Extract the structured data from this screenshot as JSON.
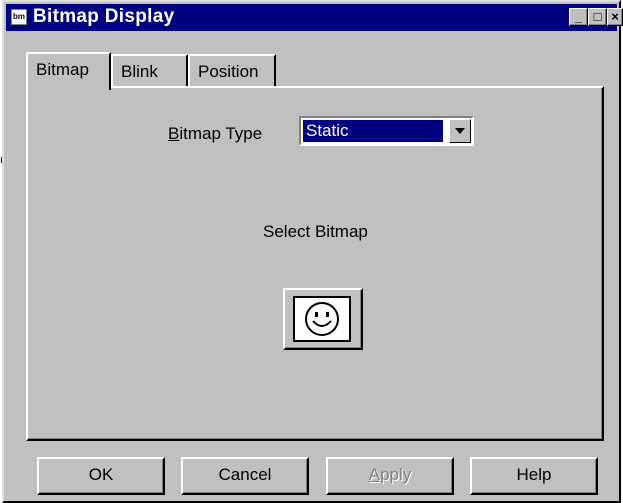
{
  "window": {
    "title": "Bitmap Display",
    "app_icon_text": "bm"
  },
  "caption_buttons": {
    "minimize": "_",
    "maximize": "□",
    "close": "×"
  },
  "edge_fragment": "o",
  "tabs": [
    {
      "label": "Bitmap",
      "active": true
    },
    {
      "label": "Blink",
      "active": false
    },
    {
      "label": "Position",
      "active": false
    }
  ],
  "bitmap_type": {
    "label_accel": "B",
    "label_rest": "itmap Type",
    "value": "Static"
  },
  "select_bitmap": {
    "label": "Select Bitmap",
    "icon": "smiley-face-icon"
  },
  "buttons": {
    "ok": "OK",
    "cancel": "Cancel",
    "apply_accel": "A",
    "apply_rest": "pply",
    "help": "Help"
  }
}
